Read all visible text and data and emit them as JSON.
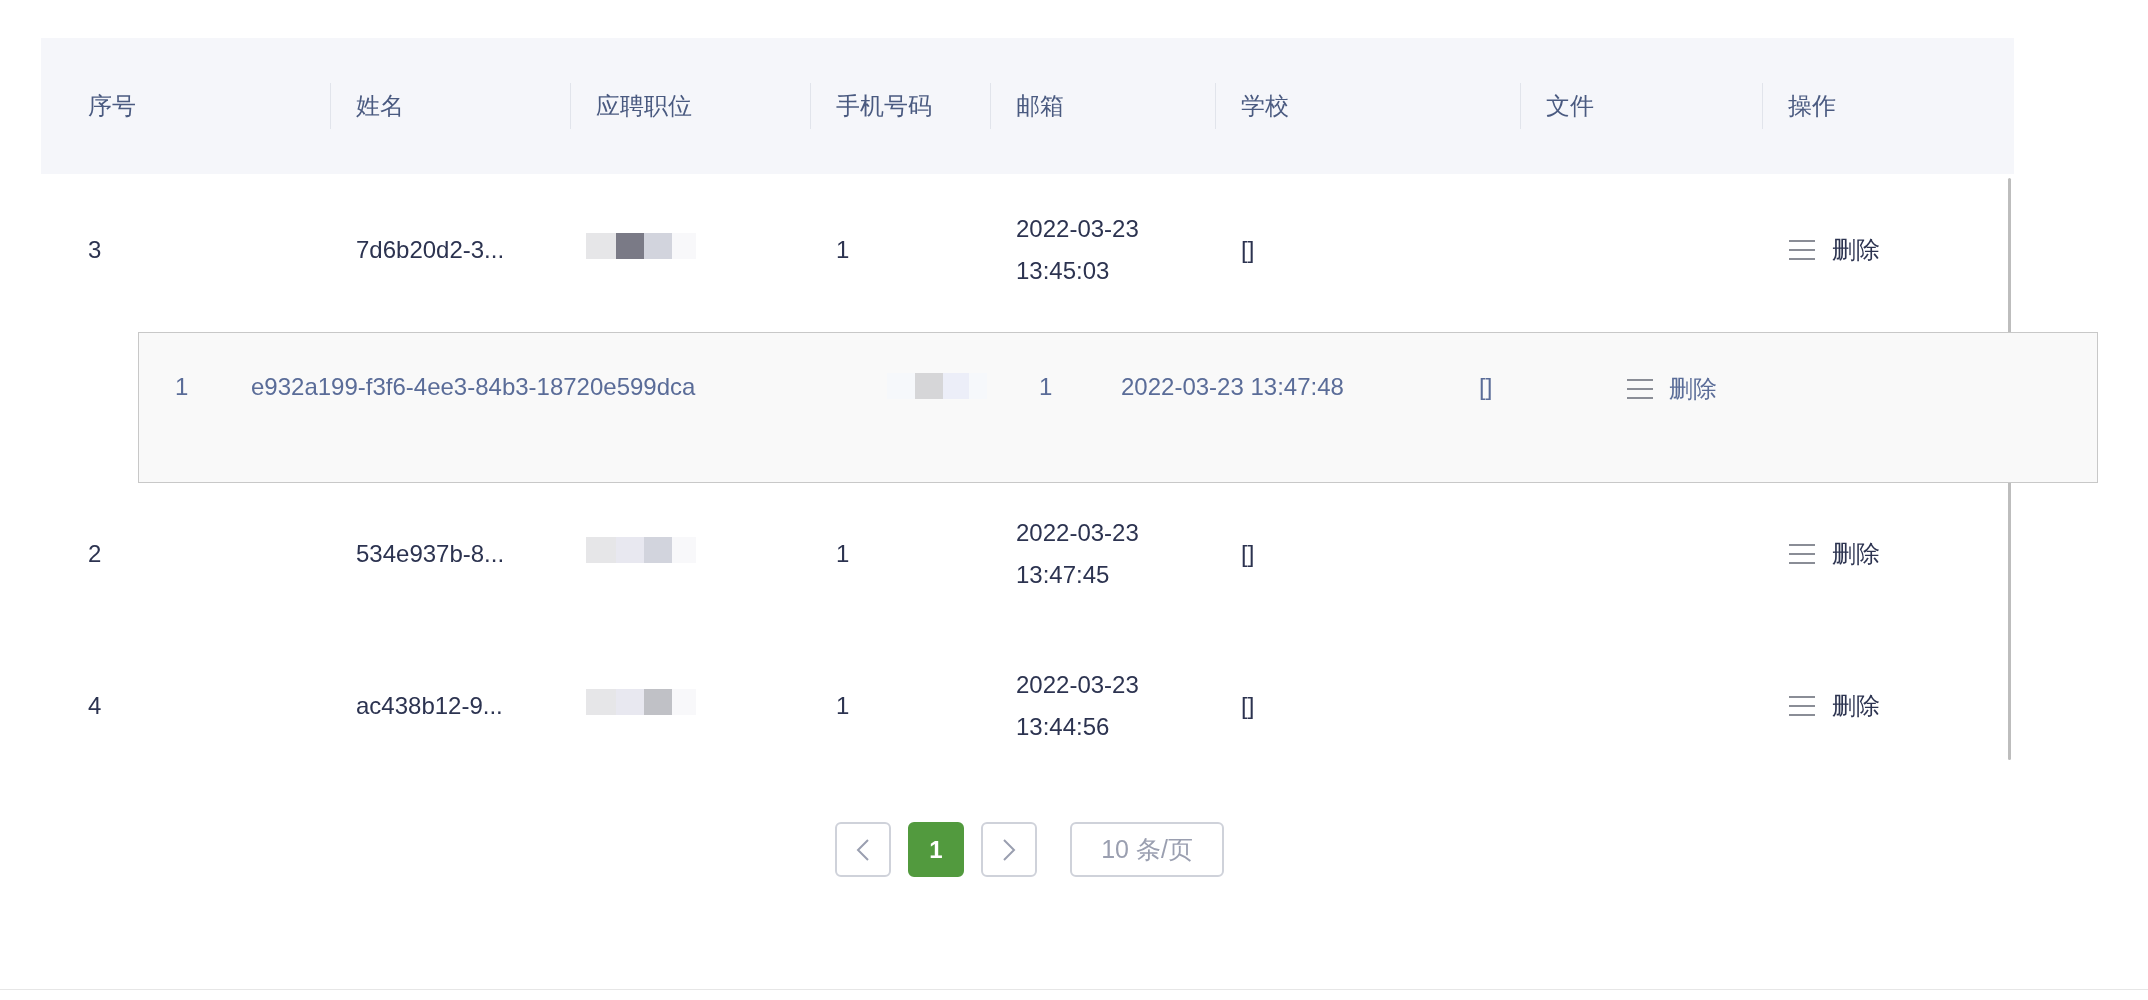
{
  "table": {
    "columns": [
      "序号",
      "姓名",
      "应聘职位",
      "手机号码",
      "邮箱",
      "学校",
      "文件",
      "操作"
    ],
    "rows": [
      {
        "index": "3",
        "name": "7d6b20d2-3...",
        "phone": "1",
        "time": "2022-03-23 13:45:03",
        "school": "[]",
        "action": "删除"
      },
      {
        "index": "2",
        "name": "534e937b-8...",
        "phone": "1",
        "time": "2022-03-23 13:47:45",
        "school": "[]",
        "action": "删除"
      },
      {
        "index": "4",
        "name": "ac438b12-9...",
        "phone": "1",
        "time": "2022-03-23 13:44:56",
        "school": "[]",
        "action": "删除"
      }
    ],
    "dragged_row": {
      "index": "1",
      "name": "e932a199-f3f6-4ee3-84b3-18720e599dca",
      "phone": "1",
      "time": "2022-03-23 13:47:48",
      "school": "[]",
      "action": "删除"
    }
  },
  "pagination": {
    "pages": [
      {
        "label": "1",
        "selected": true
      }
    ],
    "page_size": "10 条/页"
  }
}
